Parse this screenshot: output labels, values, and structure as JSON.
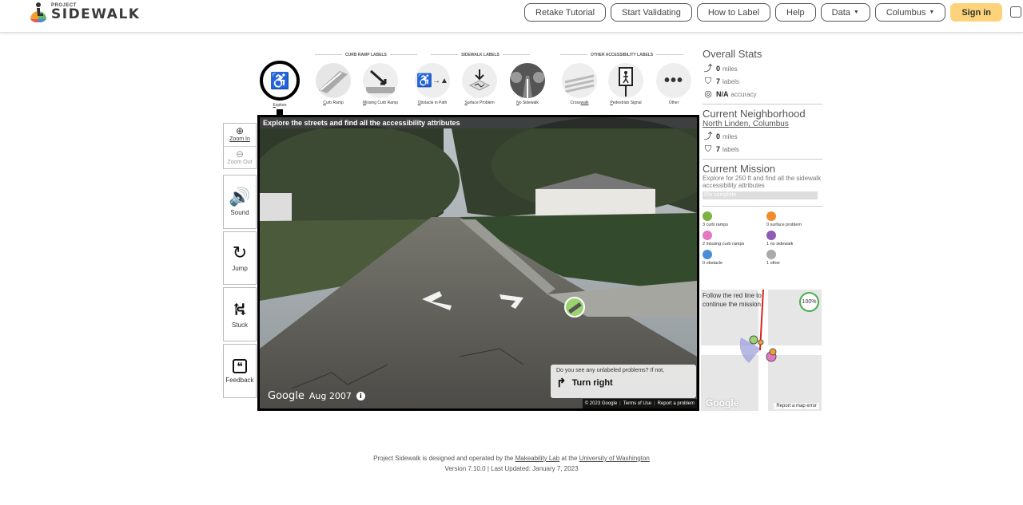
{
  "header": {
    "logo_small": "PROJECT",
    "logo_big": "SIDEWALK",
    "buttons": {
      "retake": "Retake Tutorial",
      "validate": "Start Validating",
      "how": "How to Label",
      "help": "Help",
      "data": "Data",
      "city": "Columbus",
      "signin": "Sign in"
    }
  },
  "toolbar": {
    "sections": {
      "curb": "CURB RAMP LABELS",
      "sidewalk": "SIDEWALK LABELS",
      "other": "OTHER ACCESSIBILITY LABELS"
    },
    "tools": [
      {
        "key": "explore",
        "first": "E",
        "rest": "xplore"
      },
      {
        "key": "curb-ramp",
        "first": "C",
        "rest": "urb Ramp"
      },
      {
        "key": "missing-curb-ramp",
        "first": "M",
        "rest": "issing Curb Ramp"
      },
      {
        "key": "obstacle",
        "first": "O",
        "rest": "bstacle in Path"
      },
      {
        "key": "surface-problem",
        "first": "S",
        "rest": "urface Problem"
      },
      {
        "key": "no-sidewalk",
        "first": "N",
        "rest": "o Sidewalk"
      },
      {
        "key": "crosswalk",
        "first": "Cross",
        "rest": "walk",
        "underline_second": true
      },
      {
        "key": "pedestrian-signal",
        "first": "P",
        "rest": "edestrian Signal"
      },
      {
        "key": "other",
        "first": "",
        "rest": "Other"
      }
    ]
  },
  "sidebar": {
    "zoom_in": "Zoom In",
    "zoom_out": "Zoom Out",
    "sound": "Sound",
    "jump": "Jump",
    "stuck": "Stuck",
    "feedback": "Feedback"
  },
  "streetview": {
    "banner": "Explore the streets and find all the accessibility attributes",
    "google": "Google",
    "date": "Aug 2007",
    "prompt": "Do you see any unlabeled problems? If not,",
    "turn": "Turn right",
    "copyright": "© 2023 Google",
    "terms": "Terms of Use",
    "report": "Report a problem"
  },
  "stats": {
    "overall_title": "Overall Stats",
    "overall_miles": "0",
    "miles_unit": "miles",
    "overall_labels": "7",
    "labels_unit": "labels",
    "accuracy": "N/A",
    "accuracy_unit": "accuracy",
    "neighborhood_title": "Current Neighborhood",
    "neighborhood_name": "North Linden, Columbus",
    "nbhd_miles": "0",
    "nbhd_labels": "7",
    "mission_title": "Current Mission",
    "mission_text": "Explore for 250 ft and find all the sidewalk accessibility attributes",
    "mission_progress_label": "0% complete",
    "mission_progress": 0.0
  },
  "label_counts": [
    {
      "text": "3 curb ramps",
      "color": "#7cb342"
    },
    {
      "text": "0 surface problem",
      "color": "#f08c2e"
    },
    {
      "text": "2 missing curb ramps",
      "color": "#e377c2"
    },
    {
      "text": "1 no sidewalk",
      "color": "#8e5bb5"
    },
    {
      "text": "0 obstacle",
      "color": "#4a8fd6"
    },
    {
      "text": "1 other",
      "color": "#aaaaaa"
    }
  ],
  "minimap": {
    "note": "Follow the red line to continue the mission",
    "percent": "100%",
    "google": "Google",
    "report": "Report a map error"
  },
  "footer": {
    "pre": "Project Sidewalk is designed and operated by the ",
    "lab": "Makeability Lab",
    "mid": " at the ",
    "uni": "University of Washington",
    "version": "Version 7.10.0 | Last Updated: January 7, 2023"
  }
}
